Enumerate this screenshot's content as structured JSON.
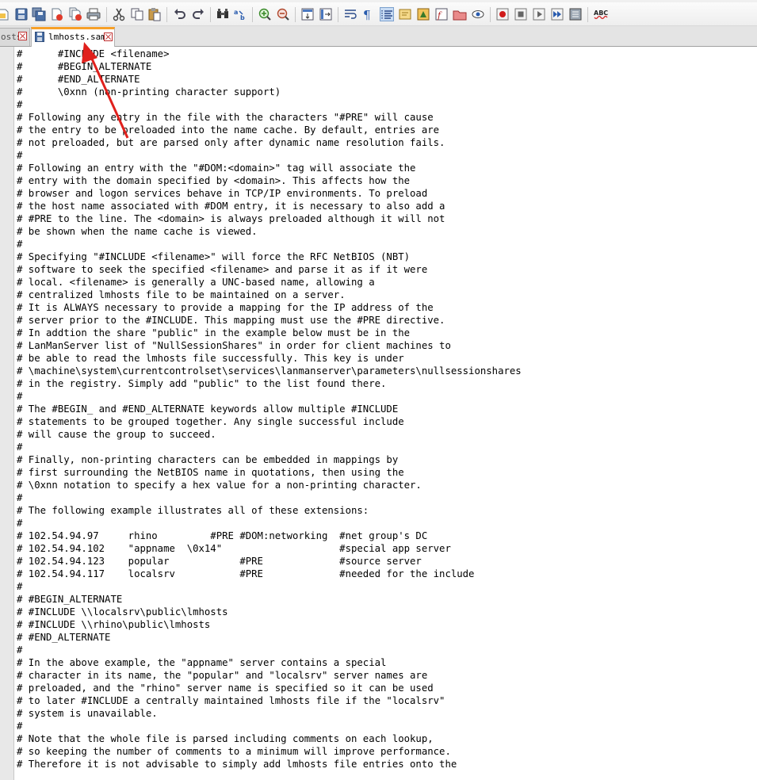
{
  "tabs": [
    {
      "label": "osts",
      "active": false
    },
    {
      "label": "lmhosts.sam",
      "active": true
    }
  ],
  "toolbar": {
    "icons": [
      "new-icon",
      "open-icon",
      "save-icon",
      "save-all-icon",
      "close-icon",
      "close-all-icon",
      "print-icon",
      "cut-icon",
      "copy-icon",
      "paste-icon",
      "undo-icon",
      "redo-icon",
      "find-icon",
      "replace-icon",
      "zoom-in-icon",
      "zoom-out-icon",
      "sync-vertical-icon",
      "sync-horizontal-icon",
      "word-wrap-icon",
      "show-all-chars-icon",
      "indent-guide-icon",
      "user-lang-icon",
      "doc-map-icon",
      "function-list-icon",
      "folder-workspace-icon",
      "monitor-icon",
      "record-macro-icon",
      "stop-macro-icon",
      "play-macro-icon",
      "run-macro-multiple-icon",
      "save-macro-icon",
      "spellcheck-icon"
    ],
    "spellcheck_label": "ABC"
  },
  "colors": {
    "tab_active_accent": "#f7a028",
    "annotation_arrow": "#e0201c",
    "close_button": "#c03030"
  },
  "editor": {
    "lines": [
      "#      #INCLUDE <filename>",
      "#      #BEGIN_ALTERNATE",
      "#      #END_ALTERNATE",
      "#      \\0xnn (non-printing character support)",
      "#",
      "# Following any entry in the file with the characters \"#PRE\" will cause",
      "# the entry to be preloaded into the name cache. By default, entries are",
      "# not preloaded, but are parsed only after dynamic name resolution fails.",
      "#",
      "# Following an entry with the \"#DOM:<domain>\" tag will associate the",
      "# entry with the domain specified by <domain>. This affects how the",
      "# browser and logon services behave in TCP/IP environments. To preload",
      "# the host name associated with #DOM entry, it is necessary to also add a",
      "# #PRE to the line. The <domain> is always preloaded although it will not",
      "# be shown when the name cache is viewed.",
      "#",
      "# Specifying \"#INCLUDE <filename>\" will force the RFC NetBIOS (NBT)",
      "# software to seek the specified <filename> and parse it as if it were",
      "# local. <filename> is generally a UNC-based name, allowing a",
      "# centralized lmhosts file to be maintained on a server.",
      "# It is ALWAYS necessary to provide a mapping for the IP address of the",
      "# server prior to the #INCLUDE. This mapping must use the #PRE directive.",
      "# In addtion the share \"public\" in the example below must be in the",
      "# LanManServer list of \"NullSessionShares\" in order for client machines to",
      "# be able to read the lmhosts file successfully. This key is under",
      "# \\machine\\system\\currentcontrolset\\services\\lanmanserver\\parameters\\nullsessionshares",
      "# in the registry. Simply add \"public\" to the list found there.",
      "#",
      "# The #BEGIN_ and #END_ALTERNATE keywords allow multiple #INCLUDE",
      "# statements to be grouped together. Any single successful include",
      "# will cause the group to succeed.",
      "#",
      "# Finally, non-printing characters can be embedded in mappings by",
      "# first surrounding the NetBIOS name in quotations, then using the",
      "# \\0xnn notation to specify a hex value for a non-printing character.",
      "#",
      "# The following example illustrates all of these extensions:",
      "#",
      "# 102.54.94.97     rhino         #PRE #DOM:networking  #net group's DC",
      "# 102.54.94.102    \"appname  \\0x14\"                    #special app server",
      "# 102.54.94.123    popular            #PRE             #source server",
      "# 102.54.94.117    localsrv           #PRE             #needed for the include",
      "#",
      "# #BEGIN_ALTERNATE",
      "# #INCLUDE \\\\localsrv\\public\\lmhosts",
      "# #INCLUDE \\\\rhino\\public\\lmhosts",
      "# #END_ALTERNATE",
      "#",
      "# In the above example, the \"appname\" server contains a special",
      "# character in its name, the \"popular\" and \"localsrv\" server names are",
      "# preloaded, and the \"rhino\" server name is specified so it can be used",
      "# to later #INCLUDE a centrally maintained lmhosts file if the \"localsrv\"",
      "# system is unavailable.",
      "#",
      "# Note that the whole file is parsed including comments on each lookup,",
      "# so keeping the number of comments to a minimum will improve performance.",
      "# Therefore it is not advisable to simply add lmhosts file entries onto the"
    ]
  }
}
